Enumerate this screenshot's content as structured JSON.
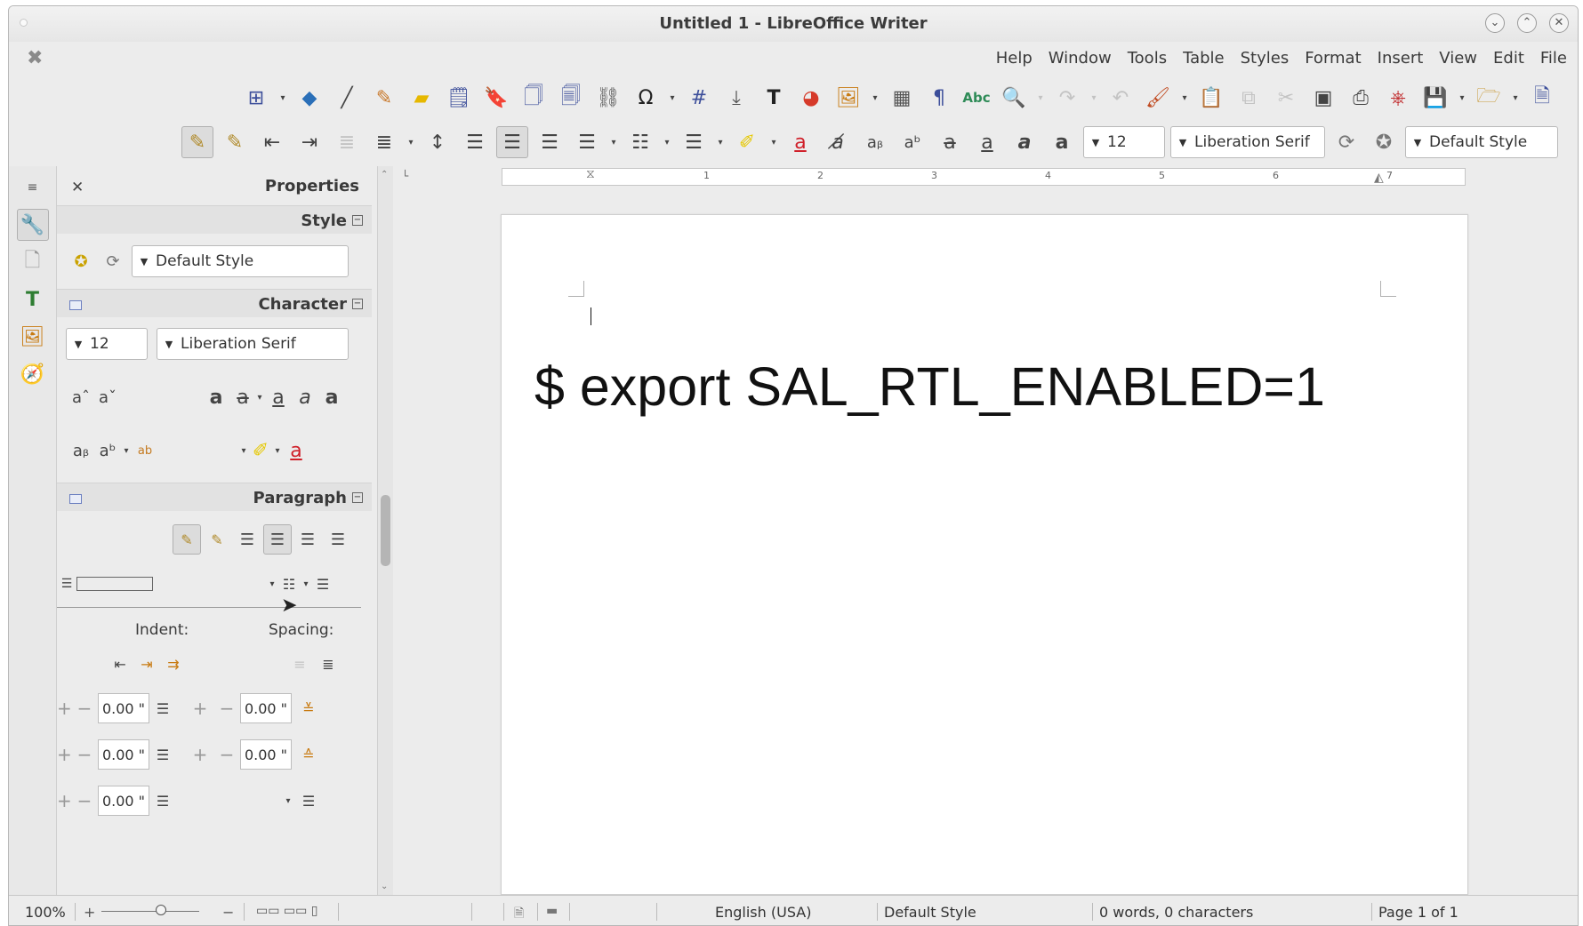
{
  "window": {
    "title": "Untitled 1 - LibreOffice Writer"
  },
  "menubar": {
    "items": [
      "File",
      "Edit",
      "View",
      "Insert",
      "Format",
      "Styles",
      "Table",
      "Tools",
      "Window",
      "Help"
    ]
  },
  "toolbar": {
    "paragraph_style": "Default Style",
    "font_name": "Liberation Serif",
    "font_size": "12"
  },
  "sidebar": {
    "title": "Properties",
    "style_section": {
      "title": "Style",
      "value": "Default Style"
    },
    "character_section": {
      "title": "Character",
      "font_size": "12",
      "font_name": "Liberation Serif"
    },
    "paragraph_section": {
      "title": "Paragraph",
      "indent_label": "Indent:",
      "spacing_label": "Spacing:",
      "indent_before": "0.00 \"",
      "indent_after": "0.00 \"",
      "first_line": "0.00 \"",
      "spacing_above": "0.00 \"",
      "spacing_below": "0.00 \""
    }
  },
  "ruler": {
    "numbers": [
      "1",
      "2",
      "3",
      "4",
      "5",
      "6",
      "7"
    ]
  },
  "document": {
    "text": "$ export SAL_RTL_ENABLED=1"
  },
  "statusbar": {
    "zoom": "100%",
    "language": "English (USA)",
    "page_style": "Default Style",
    "word_count": "0 words, 0 characters",
    "page": "Page 1 of 1"
  },
  "colors": {
    "accent": "#3c4e9a",
    "highlight": "#f5e12a",
    "font_color": "#d0202a"
  }
}
